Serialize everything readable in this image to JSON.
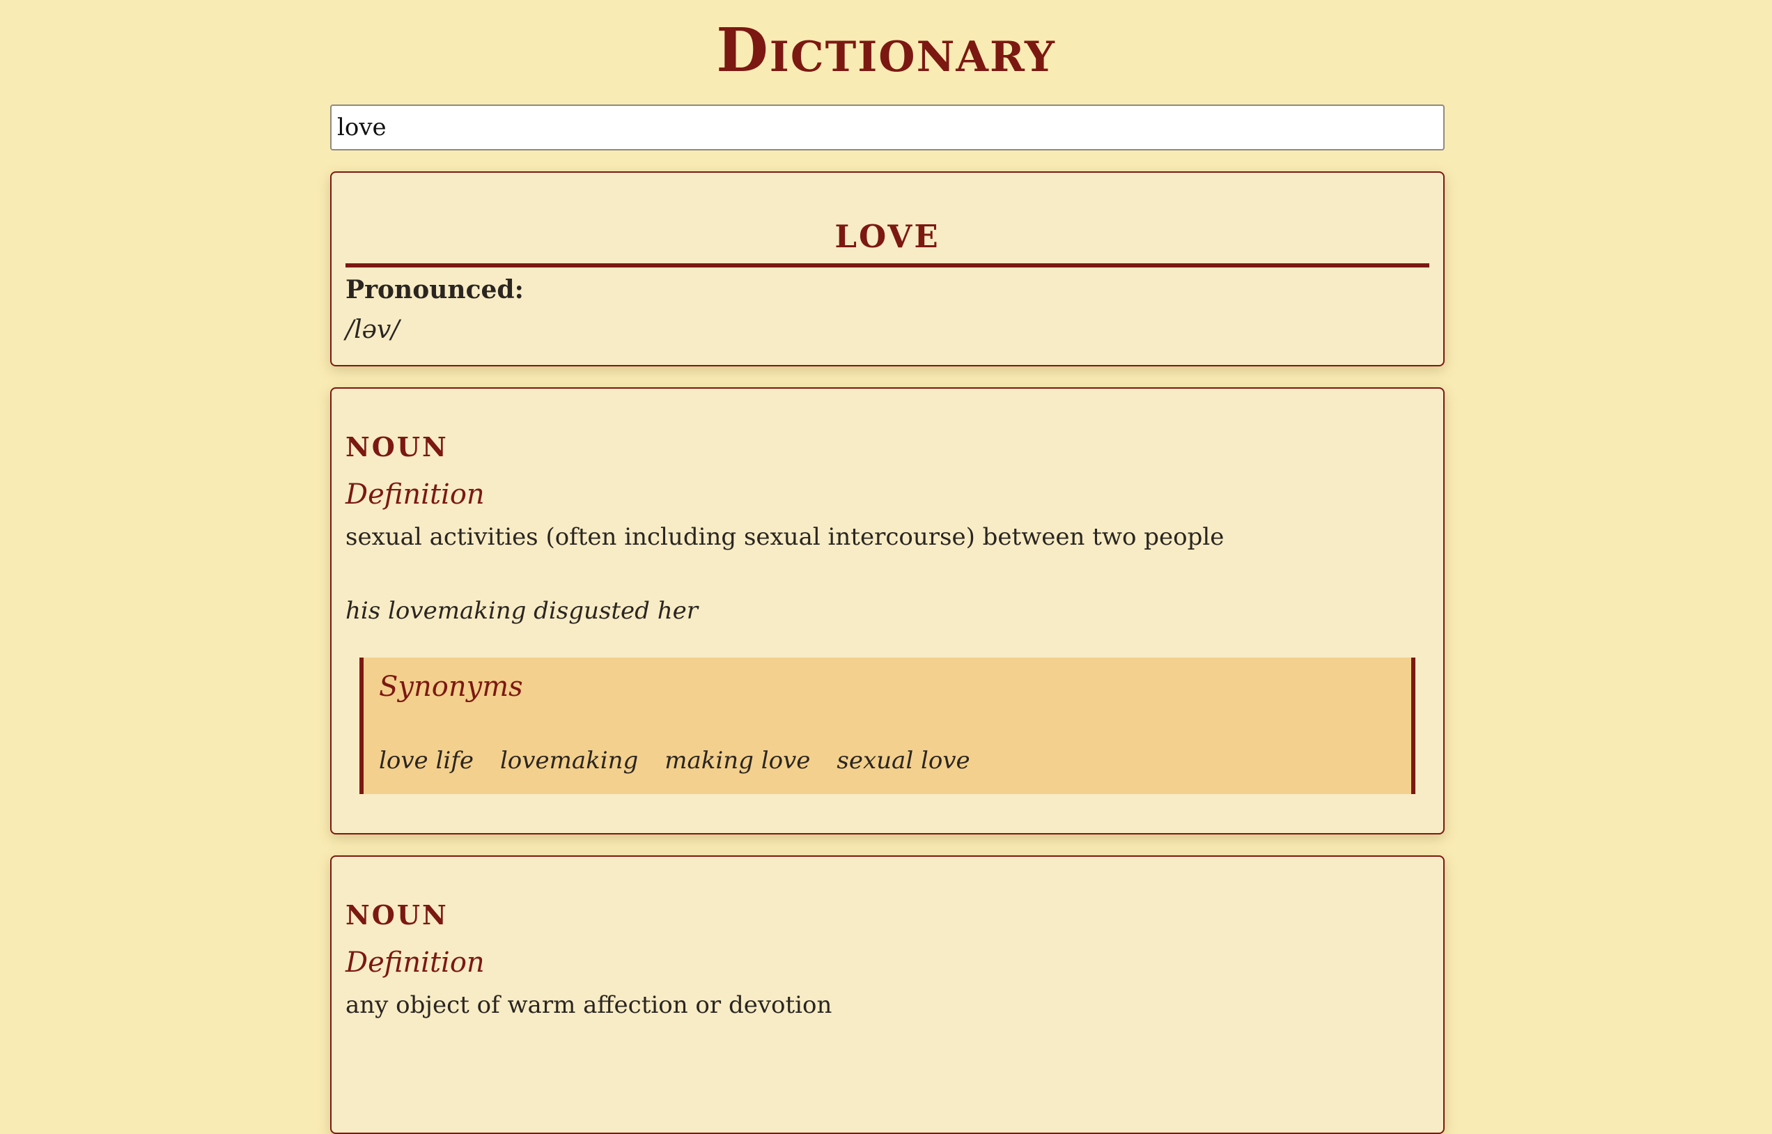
{
  "app_title": "Dictionary",
  "search": {
    "value": "love",
    "placeholder": ""
  },
  "entry": {
    "word": "love",
    "pronounced_label": "Pronounced:",
    "pronunciation": "/ləv/"
  },
  "meanings": [
    {
      "part_of_speech": "noun",
      "definition_label": "Definition",
      "definition": "sexual activities (often including sexual intercourse) between two people",
      "example": "his lovemaking disgusted her",
      "synonyms_label": "Synonyms",
      "synonyms": [
        "love life",
        "lovemaking",
        "making love",
        "sexual love"
      ]
    },
    {
      "part_of_speech": "noun",
      "definition_label": "Definition",
      "definition": "any object of warm affection or devotion"
    }
  ],
  "colors": {
    "background": "#f9ebb4",
    "card": "#f7ecc5",
    "accent": "#7c1812",
    "synonyms_bg": "#f3d08d"
  }
}
